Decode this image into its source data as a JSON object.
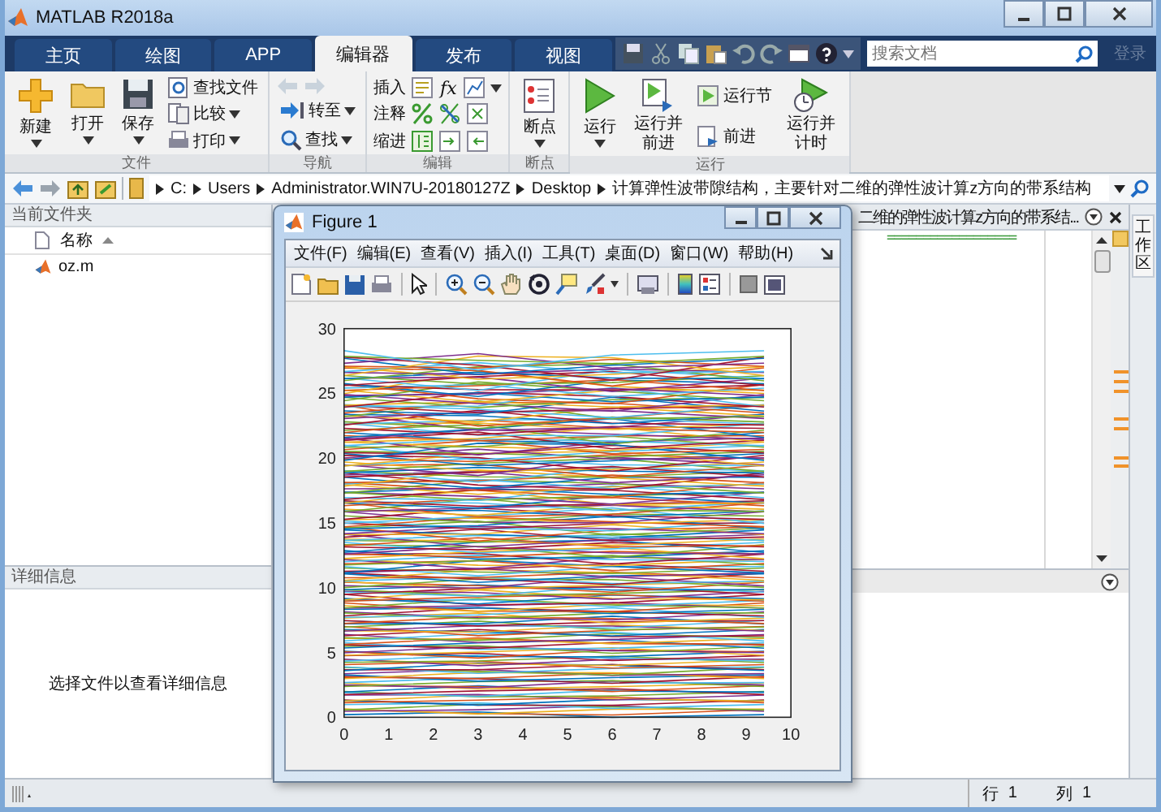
{
  "window": {
    "title": "MATLAB R2018a"
  },
  "tabs": [
    {
      "label": "主页",
      "selected": false
    },
    {
      "label": "绘图",
      "selected": false
    },
    {
      "label": "APP",
      "selected": false
    },
    {
      "label": "编辑器",
      "selected": true
    },
    {
      "label": "发布",
      "selected": false
    },
    {
      "label": "视图",
      "selected": false
    }
  ],
  "search": {
    "placeholder": "搜索文档"
  },
  "sign_in": "登录",
  "ribbon": {
    "file": {
      "title": "文件",
      "new": "新建",
      "open": "打开",
      "save": "保存",
      "find_files": "查找文件",
      "compare": "比较",
      "print": "打印"
    },
    "navigate": {
      "title": "导航",
      "go_to": "转至",
      "find": "查找"
    },
    "edit": {
      "title": "编辑",
      "insert": "插入",
      "function": "fx",
      "comment": "注释",
      "indent": "缩进"
    },
    "breakpoints": {
      "title": "断点",
      "breakpoints": "断点"
    },
    "run": {
      "title": "运行",
      "run": "运行",
      "run_advance": "运行并前进",
      "run_section": "运行节",
      "advance": "前进",
      "run_time": "运行并计时"
    }
  },
  "address": {
    "segments": [
      "C:",
      "Users",
      "Administrator.WIN7U-20180127Z",
      "Desktop",
      "计算弹性波带隙结构，主要针对二维的弹性波计算z方向的带系结构"
    ]
  },
  "current_folder": {
    "title": "当前文件夹",
    "column": "名称",
    "files": [
      "oz.m"
    ]
  },
  "details": {
    "title": "详细信息",
    "message": "选择文件以查看详细信息"
  },
  "editor": {
    "tab_title": "二维的弹性波计算z方向的带系结...",
    "code_line": "=================="
  },
  "workspace": {
    "title": "工作区"
  },
  "figure": {
    "title": "Figure 1",
    "menu": [
      "文件(F)",
      "编辑(E)",
      "查看(V)",
      "插入(I)",
      "工具(T)",
      "桌面(D)",
      "窗口(W)",
      "帮助(H)"
    ],
    "x_ticks": [
      "0",
      "1",
      "2",
      "3",
      "4",
      "5",
      "6",
      "7",
      "8",
      "9",
      "10"
    ],
    "y_ticks": [
      "30",
      "25",
      "20",
      "15",
      "10",
      "5",
      "0"
    ]
  },
  "status_bar": {
    "row_label": "行",
    "row": "1",
    "col_label": "列",
    "col": "1"
  }
}
